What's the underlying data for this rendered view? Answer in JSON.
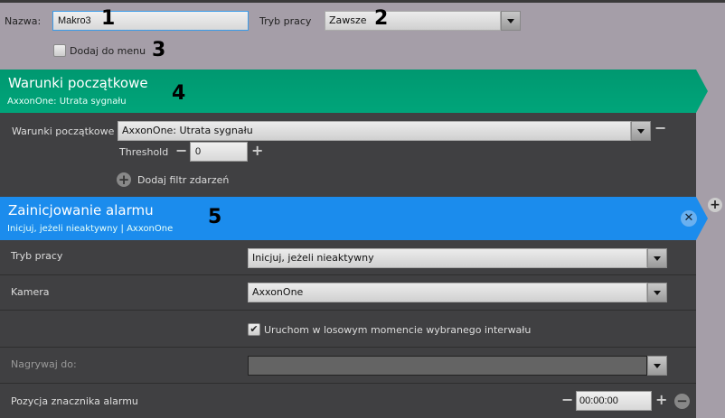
{
  "header": {
    "name_label": "Nazwa:",
    "name_value": "Makro3",
    "mode_label": "Tryb pracy",
    "mode_value": "Zawsze",
    "add_to_menu": "Dodaj do menu",
    "add_to_menu_checked": false
  },
  "annotations": [
    "1",
    "2",
    "3",
    "4",
    "5"
  ],
  "conditions": {
    "title": "Warunki początkowe",
    "subtitle": "AxxonOne: Utrata sygnału",
    "field_label": "Warunki początkowe",
    "field_value": "AxxonOne: Utrata sygnału",
    "threshold_label": "Threshold",
    "threshold_value": "0",
    "add_filter": "Dodaj filtr zdarzeń",
    "color": "#009e72"
  },
  "action": {
    "title": "Zainicjowanie alarmu",
    "subtitle": "Inicjuj, jeżeli nieaktywny | AxxonOne",
    "color": "#1b8ced",
    "mode_label": "Tryb pracy",
    "mode_value": "Inicjuj, jeżeli nieaktywny",
    "camera_label": "Kamera",
    "camera_value": "AxxonOne",
    "random_label": "Uruchom w losowym momencie wybranego interwału",
    "random_checked": true,
    "record_label": "Nagrywaj do:",
    "record_value": "",
    "position_label": "Pozycja znacznika alarmu",
    "position_value": "00:00:00"
  }
}
